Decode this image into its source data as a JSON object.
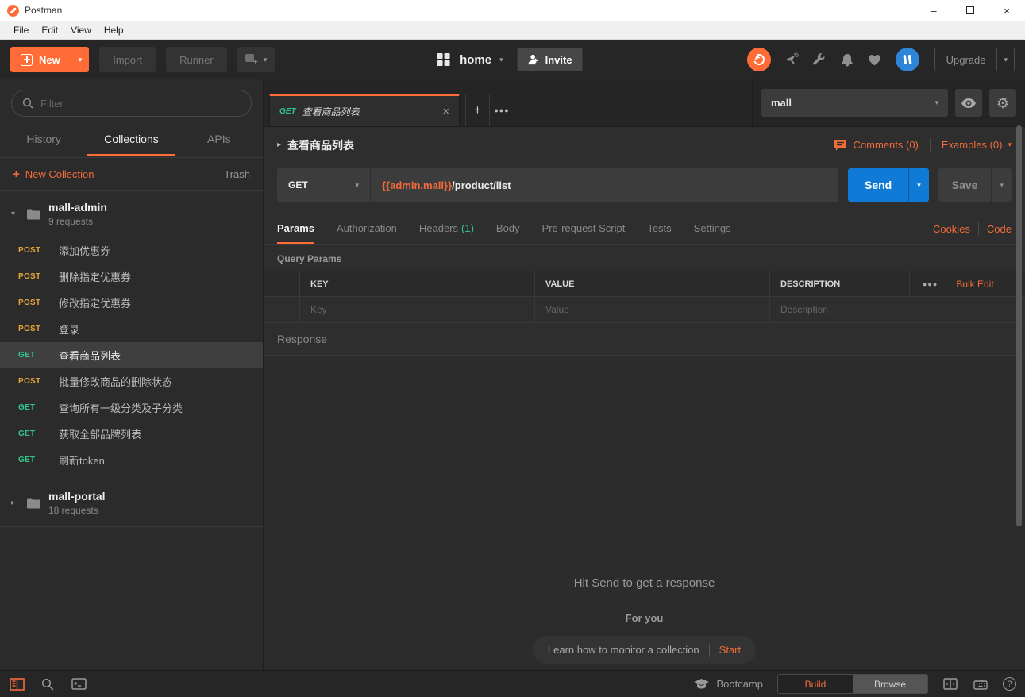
{
  "window": {
    "title": "Postman",
    "menu": [
      "File",
      "Edit",
      "View",
      "Help"
    ]
  },
  "toolbar": {
    "new_label": "New",
    "import_label": "Import",
    "runner_label": "Runner",
    "workspace_label": "home",
    "invite_label": "Invite",
    "upgrade_label": "Upgrade"
  },
  "sidebar": {
    "filter_placeholder": "Filter",
    "tabs": [
      "History",
      "Collections",
      "APIs"
    ],
    "new_collection_label": "New Collection",
    "trash_label": "Trash",
    "collections": [
      {
        "name": "mall-admin",
        "count": "9 requests",
        "requests": [
          {
            "method": "POST",
            "name": "添加优惠券"
          },
          {
            "method": "POST",
            "name": "删除指定优惠券"
          },
          {
            "method": "POST",
            "name": "修改指定优惠券"
          },
          {
            "method": "POST",
            "name": "登录"
          },
          {
            "method": "GET",
            "name": "查看商品列表"
          },
          {
            "method": "POST",
            "name": "批量修改商品的删除状态"
          },
          {
            "method": "GET",
            "name": "查询所有一级分类及子分类"
          },
          {
            "method": "GET",
            "name": "获取全部品牌列表"
          },
          {
            "method": "GET",
            "name": "刷新token"
          }
        ]
      },
      {
        "name": "mall-portal",
        "count": "18 requests"
      }
    ]
  },
  "main": {
    "tab": {
      "method": "GET",
      "title": "查看商品列表"
    },
    "environment": {
      "selected": "mall"
    },
    "request": {
      "title": "查看商品列表",
      "comments_label": "Comments (0)",
      "examples_label": "Examples (0)",
      "method": "GET",
      "url_variable": "{{admin.mall}}",
      "url_path": "/product/list",
      "send_label": "Send",
      "save_label": "Save",
      "tabs": [
        "Params",
        "Authorization",
        "Headers",
        "Body",
        "Pre-request Script",
        "Tests",
        "Settings"
      ],
      "headers_count": "(1)",
      "cookies_label": "Cookies",
      "code_label": "Code",
      "query_params_label": "Query Params",
      "table": {
        "columns": [
          "KEY",
          "VALUE",
          "DESCRIPTION"
        ],
        "bulk_edit_label": "Bulk Edit",
        "placeholders": {
          "key": "Key",
          "value": "Value",
          "description": "Description"
        }
      }
    },
    "response": {
      "label": "Response",
      "empty_title": "Hit Send to get a response",
      "for_you_label": "For you",
      "promo_text": "Learn how to monitor a collection",
      "promo_action": "Start"
    }
  },
  "statusbar": {
    "bootcamp_label": "Bootcamp",
    "build_label": "Build",
    "browse_label": "Browse"
  },
  "icons": {
    "caret_down": "▾",
    "caret_right": "▸",
    "close": "×",
    "plus": "+",
    "more": "●●●",
    "gear": "⚙",
    "minimize": "–",
    "question": "?"
  },
  "colors": {
    "brand_orange": "#ff6c37",
    "link_orange": "#f26b3a",
    "get_green": "#31c48d",
    "post_gold": "#e5a43b",
    "send_blue": "#0f7bd7"
  }
}
